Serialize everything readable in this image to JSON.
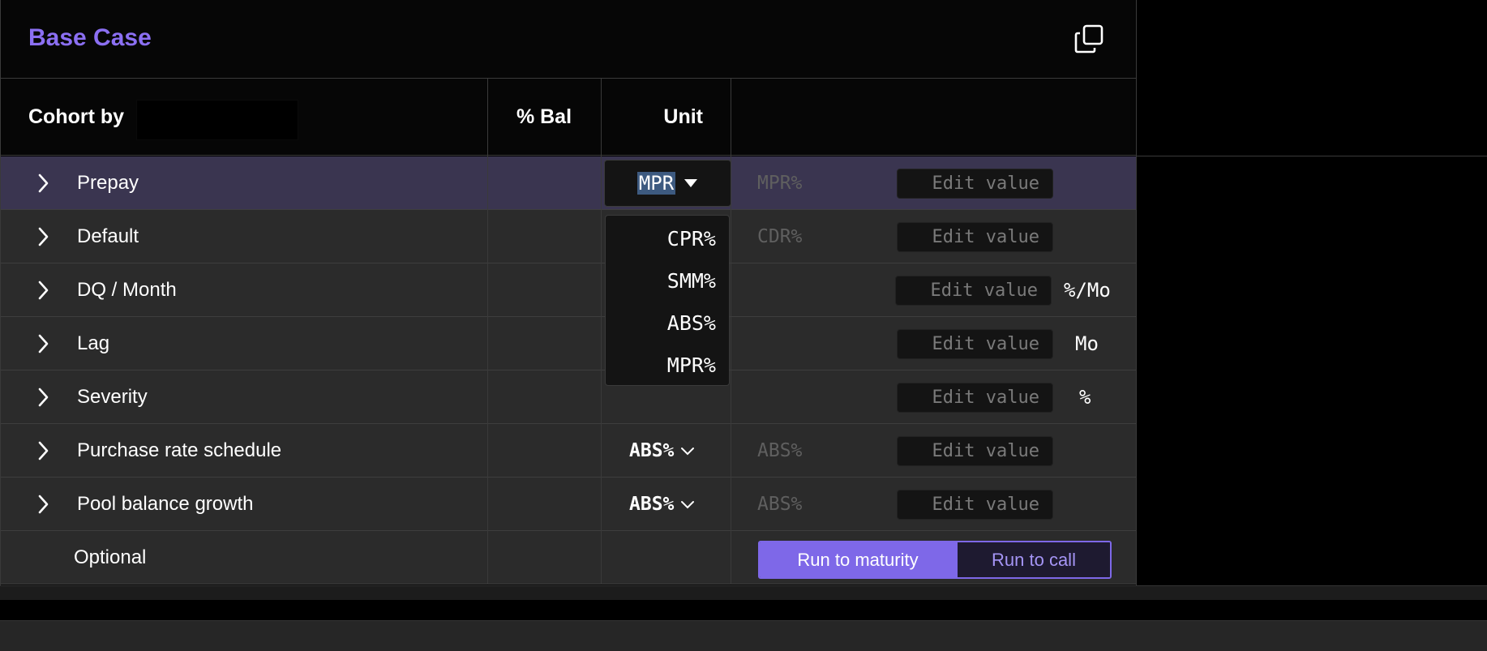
{
  "header": {
    "title": "Base Case",
    "copy_icon": "copy-icon"
  },
  "columns": {
    "cohort_label": "Cohort by",
    "cohort_value": "",
    "pct_bal": "% Bal",
    "unit": "Unit"
  },
  "rows": [
    {
      "label": "Prepay",
      "unit_value": "MPR",
      "unit_text": "MPR%",
      "edit_placeholder": "Edit value",
      "suffix": ""
    },
    {
      "label": "Default",
      "unit_value": "",
      "unit_text": "CDR%",
      "edit_placeholder": "Edit value",
      "suffix": ""
    },
    {
      "label": "DQ / Month",
      "unit_value": "",
      "unit_text": "",
      "edit_placeholder": "Edit value",
      "suffix": "%/Mo"
    },
    {
      "label": "Lag",
      "unit_value": "",
      "unit_text": "",
      "edit_placeholder": "Edit value",
      "suffix": "Mo"
    },
    {
      "label": "Severity",
      "unit_value": "",
      "unit_text": "",
      "edit_placeholder": "Edit value",
      "suffix": "%"
    },
    {
      "label": "Purchase rate schedule",
      "unit_value": "ABS%",
      "unit_text": "ABS%",
      "edit_placeholder": "Edit value",
      "suffix": ""
    },
    {
      "label": "Pool balance growth",
      "unit_value": "ABS%",
      "unit_text": "ABS%",
      "edit_placeholder": "Edit value",
      "suffix": ""
    }
  ],
  "optional": {
    "label": "Optional",
    "run_to_maturity": "Run to maturity",
    "run_to_call": "Run to call",
    "selected": "Run to maturity"
  },
  "unit_dropdown": {
    "options": [
      "CPR%",
      "SMM%",
      "ABS%",
      "MPR%"
    ]
  },
  "colors": {
    "accent": "#7e68e8",
    "title": "#8b6ff2",
    "selected_row": "#3a3550"
  }
}
